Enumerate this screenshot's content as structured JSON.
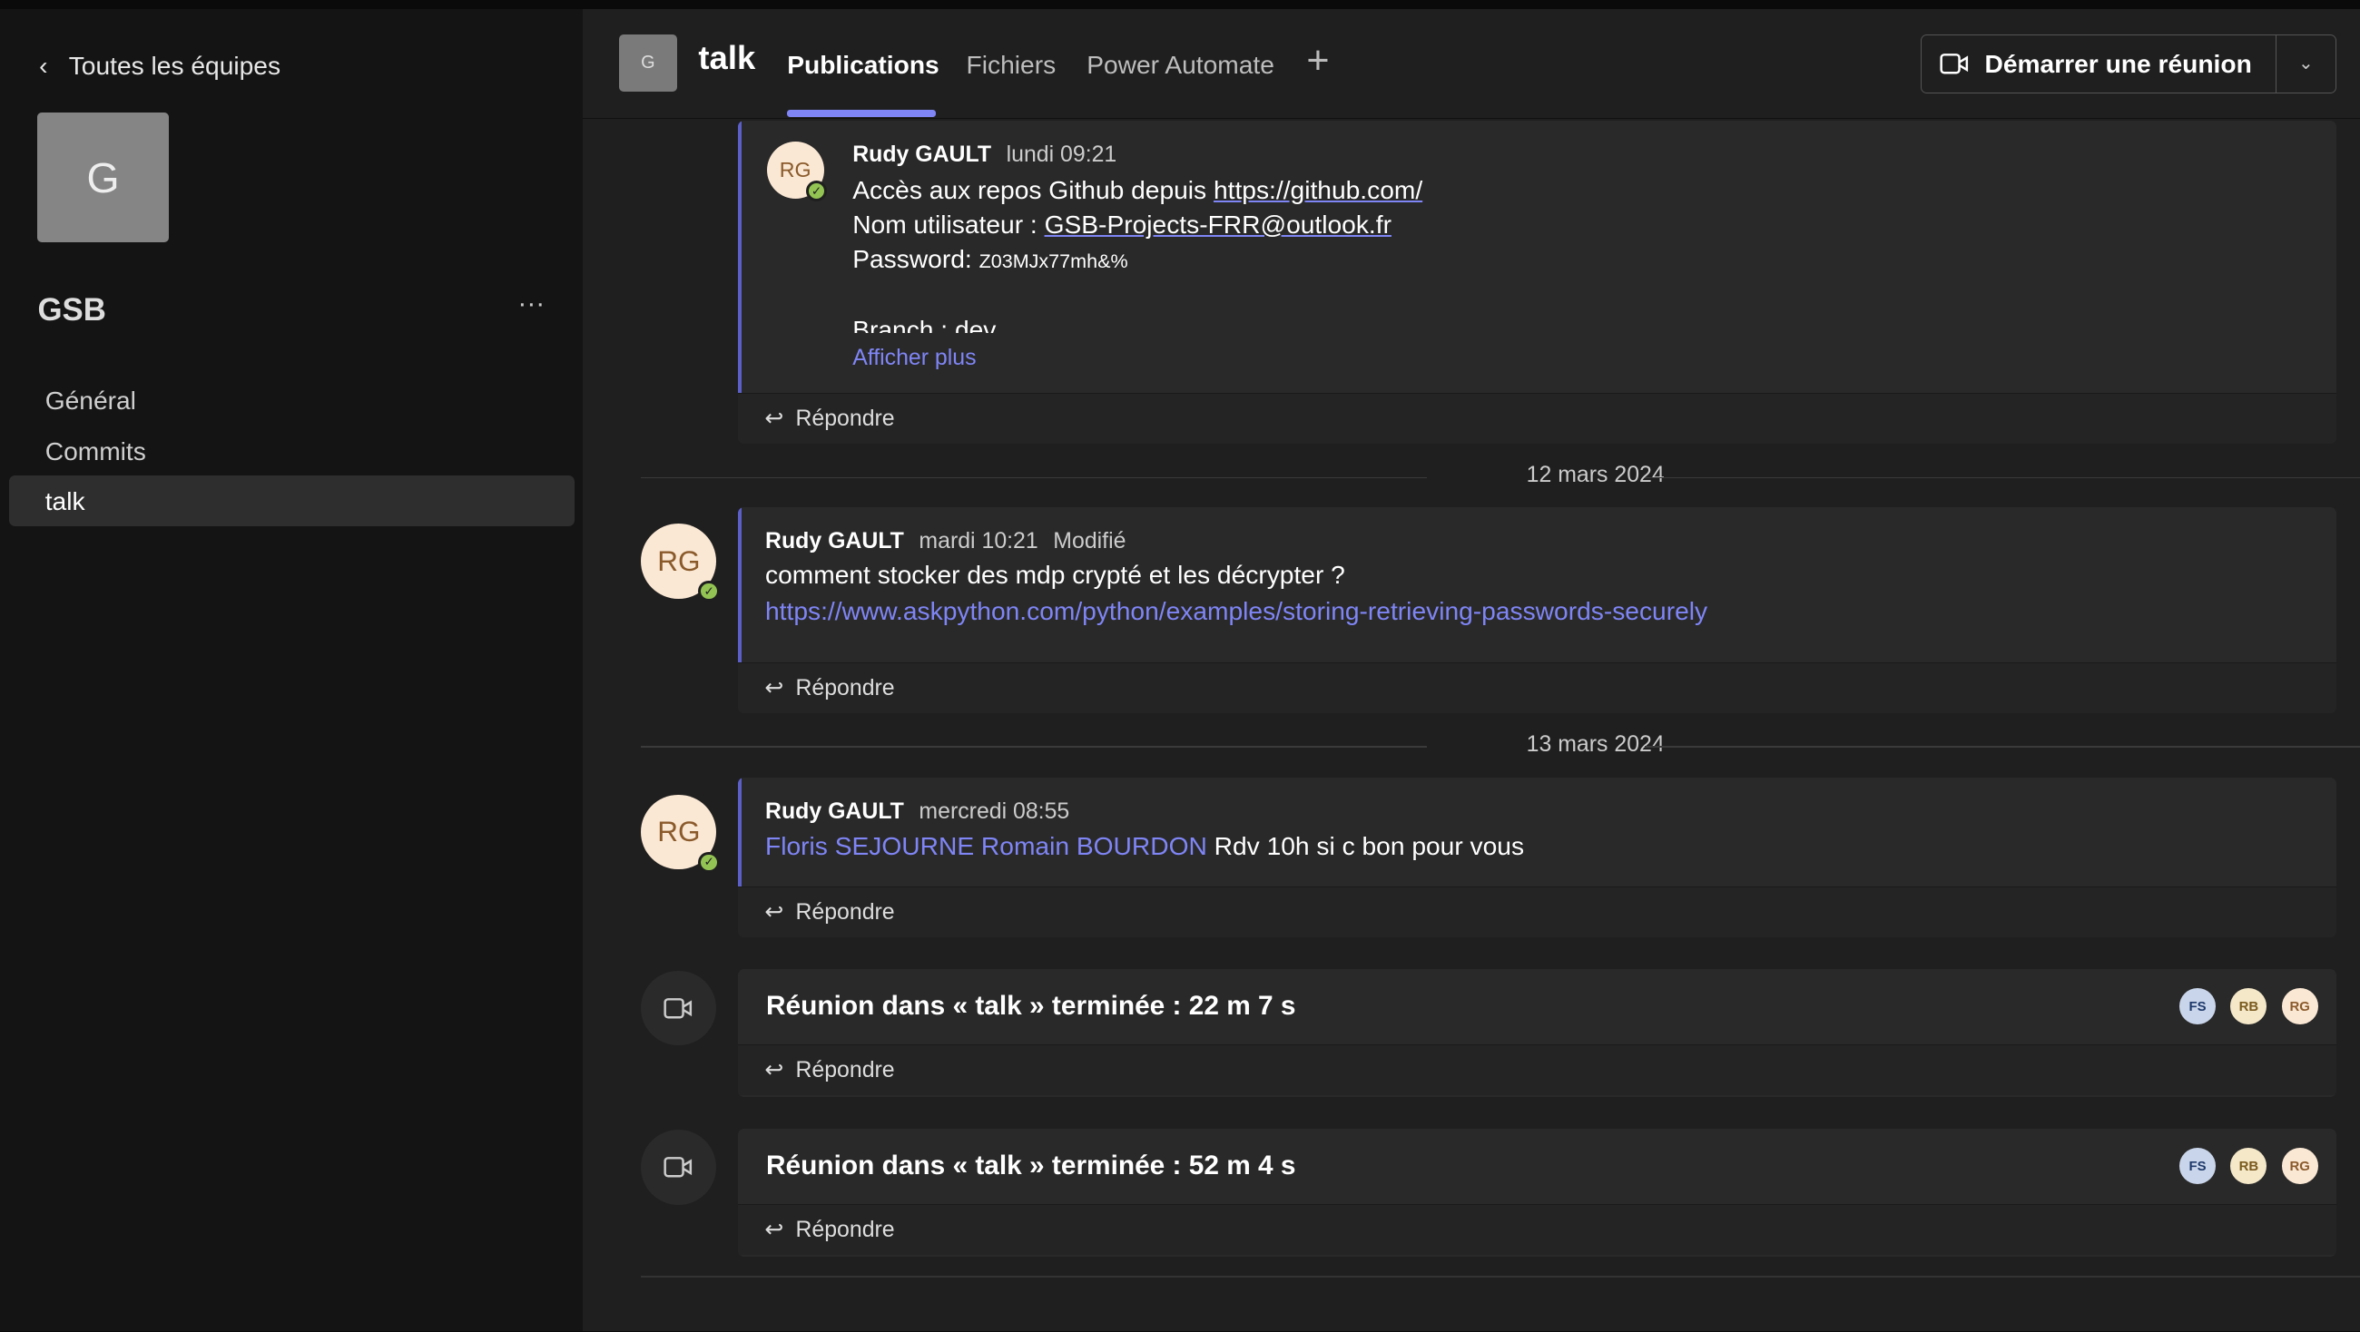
{
  "sidebar": {
    "back_label": "Toutes les équipes",
    "team_initial": "G",
    "team_name": "GSB",
    "more": "···",
    "channels": [
      {
        "label": "Général"
      },
      {
        "label": "Commits"
      },
      {
        "label": "talk",
        "active": true
      }
    ]
  },
  "header": {
    "channel_initial": "G",
    "channel_name": "talk",
    "tabs": [
      {
        "label": "Publications",
        "active": true
      },
      {
        "label": "Fichiers"
      },
      {
        "label": "Power Automate"
      }
    ],
    "add_tab": "+",
    "meet_label": "Démarrer une réunion",
    "accent": "#7f85f5"
  },
  "posts": [
    {
      "initials": "RG",
      "author": "Rudy GAULT",
      "time": "lundi 09:21",
      "line1_text": "Accès aux repos Github depuis ",
      "line1_link": "https://github.com/",
      "line2_text": "Nom utilisateur : ",
      "line2_link": "GSB-Projects-FRR@outlook.fr",
      "line3_label": "Password: ",
      "line3_value": "Z03MJx77mh&%",
      "line4": "Branch : dev",
      "show_more": "Afficher plus",
      "reply": "Répondre"
    },
    {
      "date": "12 mars 2024",
      "initials": "RG",
      "author": "Rudy GAULT",
      "time": "mardi 10:21",
      "edited": "Modifié",
      "text": "comment stocker des mdp crypté et les décrypter ?",
      "link": "https://www.askpython.com/python/examples/storing-retrieving-passwords-securely",
      "reply": "Répondre"
    },
    {
      "date": "13 mars 2024",
      "initials": "RG",
      "author": "Rudy GAULT",
      "time": "mercredi 08:55",
      "mention": "Floris SEJOURNE Romain BOURDON",
      "text": " Rdv 10h si c bon pour vous",
      "reply": "Répondre"
    }
  ],
  "meetings": [
    {
      "title": "Réunion dans « talk » terminée : 22 m 7 s",
      "participants": [
        "FS",
        "RB",
        "RG"
      ],
      "reply": "Répondre"
    },
    {
      "title": "Réunion dans « talk » terminée : 52 m 4 s",
      "participants": [
        "FS",
        "RB",
        "RG"
      ],
      "reply": "Répondre"
    }
  ]
}
